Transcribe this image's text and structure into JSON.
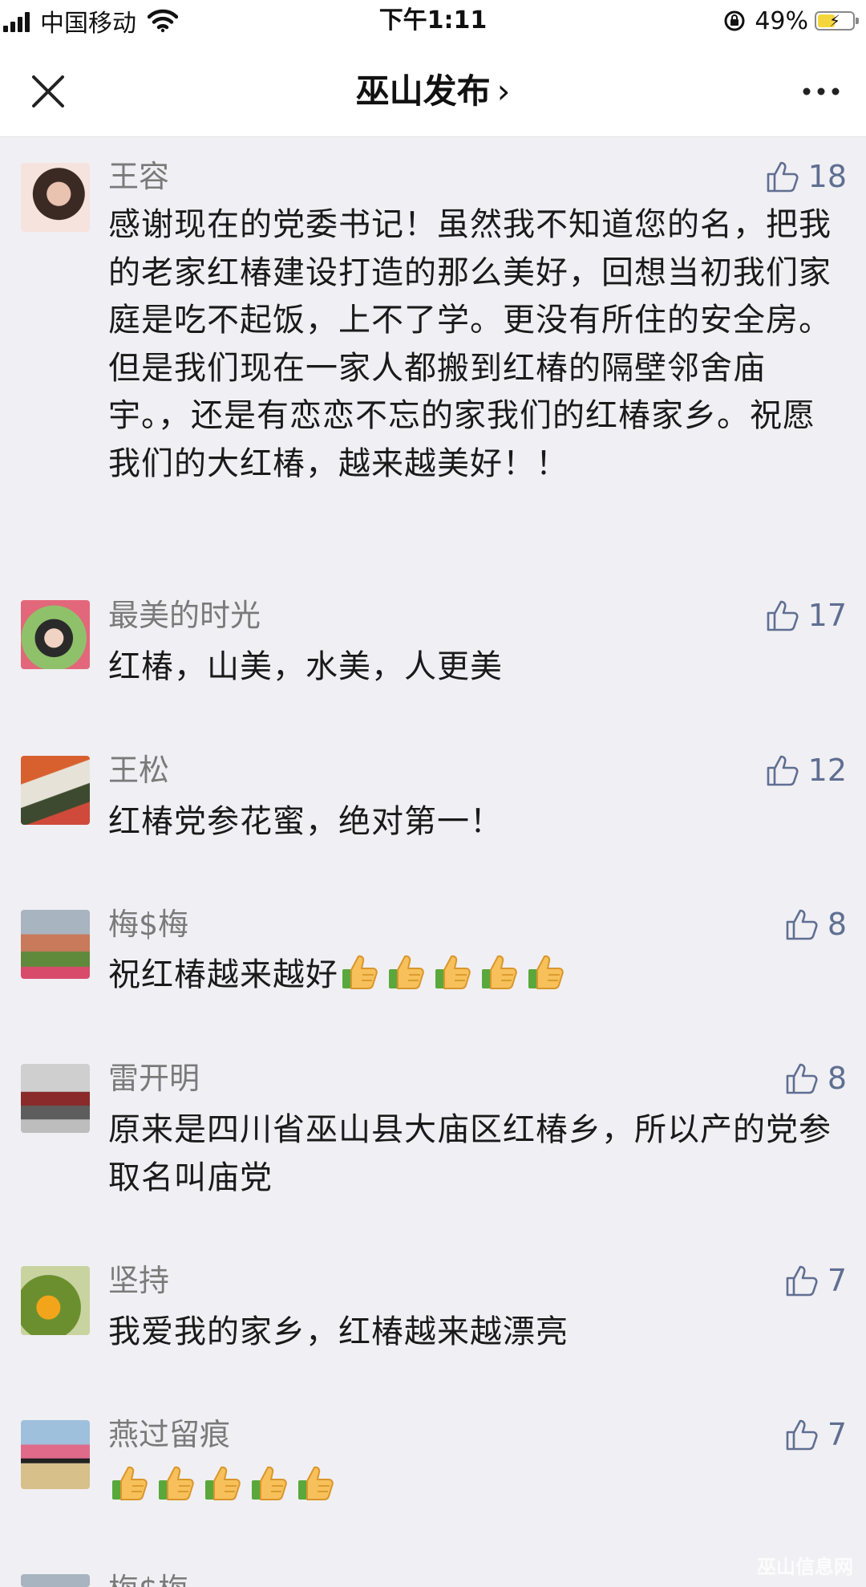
{
  "status_bar": {
    "carrier": "中国移动",
    "time": "下午1:11",
    "battery_percent": "49%",
    "battery_level": 0.49
  },
  "nav": {
    "title": "巫山发布",
    "chevron": "›"
  },
  "comments": [
    {
      "name": "王容",
      "likes": "18",
      "text": "感谢现在的党委书记！虽然我不知道您的名，把我的老家红椿建设打造的那么美好，回想当初我们家庭是吃不起饭，上不了学。更没有所住的安全房。但是我们现在一家人都搬到红椿的隔壁邻舍庙宇。，还是有恋恋不忘的家我们的红椿家乡。祝愿我们的大红椿，越来越美好！！"
    },
    {
      "name": "最美的时光",
      "likes": "17",
      "text": "红椿，山美，水美，人更美"
    },
    {
      "name": "王松",
      "likes": "12",
      "text": "红椿党参花蜜，绝对第一！"
    },
    {
      "name": "梅$梅",
      "likes": "8",
      "text": "祝红椿越来越好",
      "emoji_count": 5
    },
    {
      "name": "雷开明",
      "likes": "8",
      "text": "原来是四川省巫山县大庙区红椿乡，所以产的党参取名叫庙党"
    },
    {
      "name": "坚持",
      "likes": "7",
      "text": "我爱我的家乡，红椿越来越漂亮"
    },
    {
      "name": "燕过留痕",
      "likes": "7",
      "text": "",
      "emoji_count": 5
    },
    {
      "name": "梅$梅",
      "likes": "",
      "text": ""
    }
  ],
  "watermark": "巫山信息网",
  "colors": {
    "background": "#f0eff4",
    "like_blue": "#5f6f91",
    "name_gray": "#7a7a7a"
  }
}
